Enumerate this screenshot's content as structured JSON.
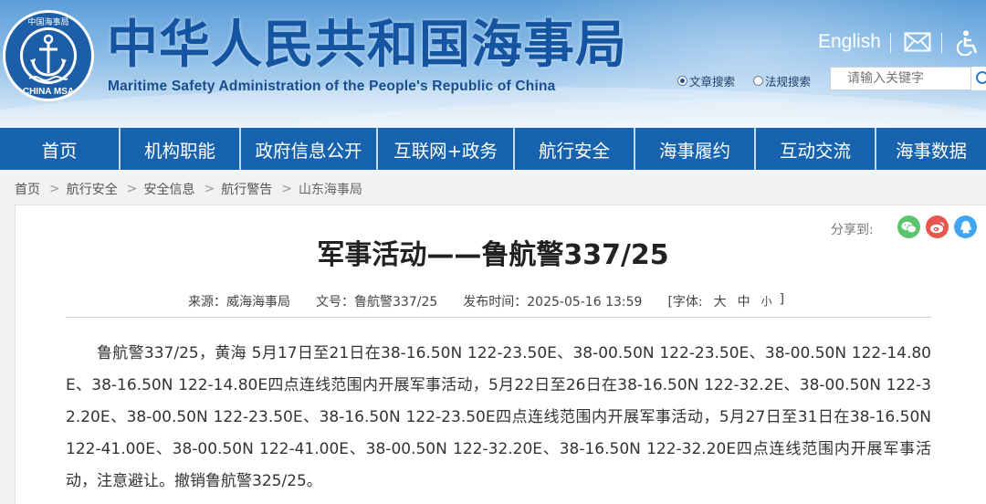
{
  "header": {
    "logo_text_cn": "中国海事局",
    "logo_text_en": "CHINA MSA",
    "title_cn": "中华人民共和国海事局",
    "title_en": "Maritime Safety Administration of the People's Republic of China",
    "english_link": "English",
    "search": {
      "option_article": "文章搜索",
      "option_law": "法规搜索",
      "placeholder": "请输入关键字"
    }
  },
  "nav": {
    "items": [
      "首页",
      "机构职能",
      "政府信息公开",
      "互联网+政务",
      "航行安全",
      "海事履约",
      "互动交流",
      "海事数据"
    ]
  },
  "breadcrumb": [
    "首页",
    "航行安全",
    "安全信息",
    "航行警告",
    "山东海事局"
  ],
  "article": {
    "share_label": "分享到:",
    "title": "军事活动——鲁航警337/25",
    "meta": {
      "source": "来源：威海海事局",
      "doc_no": "文号：鲁航警337/25",
      "publish_time": "发布时间：2025-05-16 13:59",
      "font_label": "[字体:",
      "font_large": "大",
      "font_medium": "中",
      "font_small": "小",
      "font_close": "]"
    },
    "body": "鲁航警337/25，黄海 5月17日至21日在38-16.50N 122-23.50E、38-00.50N 122-23.50E、38-00.50N 122-14.80E、38-16.50N 122-14.80E四点连线范围内开展军事活动，5月22日至26日在38-16.50N 122-32.2E、38-00.50N 122-32.20E、38-00.50N 122-23.50E、38-16.50N 122-23.50E四点连线范围内开展军事活动，5月27日至31日在38-16.50N 122-41.00E、38-00.50N 122-41.00E、38-00.50N 122-32.20E、38-16.50N 122-32.20E四点连线范围内开展军事活动，注意避让。撤销鲁航警325/25。"
  },
  "colors": {
    "nav_bg": "#1863ae",
    "title_blue": "#1554a0",
    "header_sky": "#8cbde8"
  }
}
